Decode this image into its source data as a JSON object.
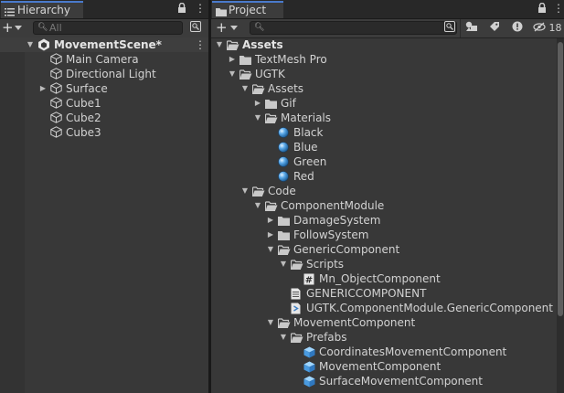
{
  "hierarchy": {
    "tab_label": "Hierarchy",
    "search_placeholder": "All",
    "scene_name": "MovementScene*",
    "items": [
      {
        "label": "Main Camera",
        "expandable": false
      },
      {
        "label": "Directional Light",
        "expandable": false
      },
      {
        "label": "Surface",
        "expandable": true
      },
      {
        "label": "Cube1",
        "expandable": false
      },
      {
        "label": "Cube2",
        "expandable": false
      },
      {
        "label": "Cube3",
        "expandable": false
      }
    ]
  },
  "project": {
    "tab_label": "Project",
    "hidden_count": "18",
    "tree": [
      {
        "label": "Assets",
        "depth": 0,
        "state": "open",
        "icon": "folder-open-icon",
        "bold": true
      },
      {
        "label": "TextMesh Pro",
        "depth": 1,
        "state": "closed",
        "icon": "folder-icon"
      },
      {
        "label": "UGTK",
        "depth": 1,
        "state": "open",
        "icon": "folder-open-icon"
      },
      {
        "label": "Assets",
        "depth": 2,
        "state": "open",
        "icon": "folder-open-icon"
      },
      {
        "label": "Gif",
        "depth": 3,
        "state": "closed",
        "icon": "folder-icon"
      },
      {
        "label": "Materials",
        "depth": 3,
        "state": "open",
        "icon": "folder-open-icon"
      },
      {
        "label": "Black",
        "depth": 4,
        "state": "none",
        "icon": "material-icon"
      },
      {
        "label": "Blue",
        "depth": 4,
        "state": "none",
        "icon": "material-icon"
      },
      {
        "label": "Green",
        "depth": 4,
        "state": "none",
        "icon": "material-icon"
      },
      {
        "label": "Red",
        "depth": 4,
        "state": "none",
        "icon": "material-icon"
      },
      {
        "label": "Code",
        "depth": 2,
        "state": "open",
        "icon": "folder-open-icon"
      },
      {
        "label": "ComponentModule",
        "depth": 3,
        "state": "open",
        "icon": "folder-open-icon"
      },
      {
        "label": "DamageSystem",
        "depth": 4,
        "state": "closed",
        "icon": "folder-icon"
      },
      {
        "label": "FollowSystem",
        "depth": 4,
        "state": "closed",
        "icon": "folder-icon"
      },
      {
        "label": "GenericComponent",
        "depth": 4,
        "state": "open",
        "icon": "folder-open-icon"
      },
      {
        "label": "Scripts",
        "depth": 5,
        "state": "open",
        "icon": "folder-open-icon"
      },
      {
        "label": "Mn_ObjectComponent",
        "depth": 6,
        "state": "none",
        "icon": "csharp-script-icon"
      },
      {
        "label": "GENERICCOMPONENT",
        "depth": 5,
        "state": "none",
        "icon": "text-file-icon"
      },
      {
        "label": "UGTK.ComponentModule.GenericComponent",
        "depth": 5,
        "state": "none",
        "icon": "assembly-definition-icon"
      },
      {
        "label": "MovementComponent",
        "depth": 4,
        "state": "open",
        "icon": "folder-open-icon"
      },
      {
        "label": "Prefabs",
        "depth": 5,
        "state": "open",
        "icon": "folder-open-icon"
      },
      {
        "label": "CoordinatesMovementComponent",
        "depth": 6,
        "state": "none",
        "icon": "prefab-icon"
      },
      {
        "label": "MovementComponent",
        "depth": 6,
        "state": "none",
        "icon": "prefab-icon"
      },
      {
        "label": "SurfaceMovementComponent",
        "depth": 6,
        "state": "none",
        "icon": "prefab-icon"
      }
    ]
  },
  "colors": {
    "panel_bg": "#383838",
    "tab_accent": "#4a7acb",
    "material_blue": "#5aa8e8",
    "prefab_blue": "#6cb8f0"
  }
}
